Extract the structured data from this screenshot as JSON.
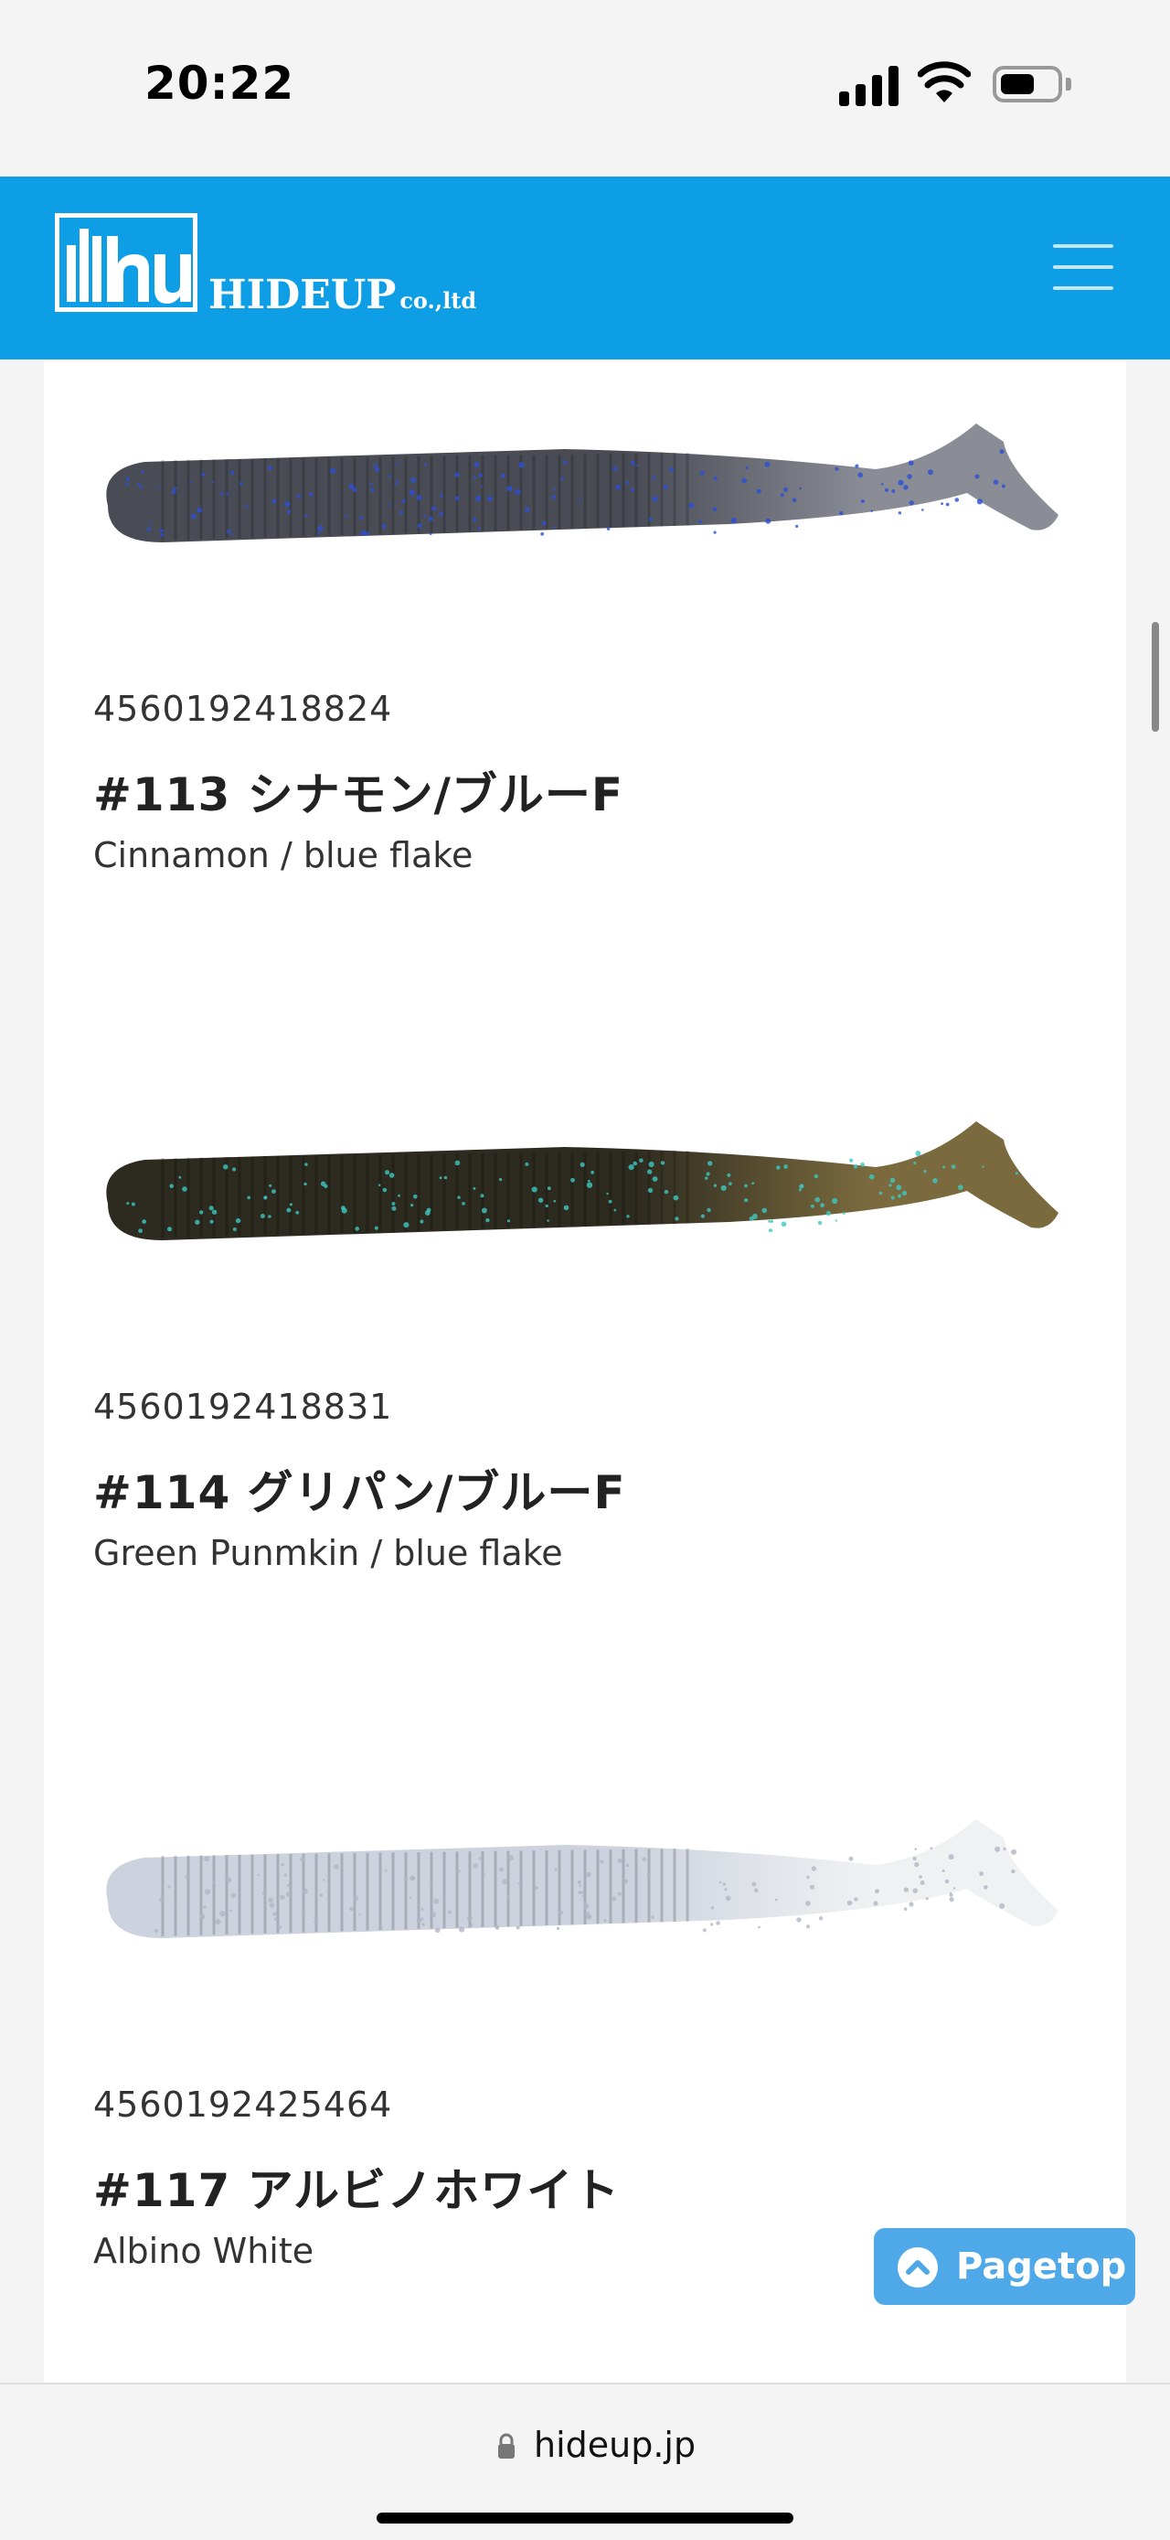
{
  "status_bar": {
    "time": "20:22",
    "icons": [
      "signal-icon",
      "wifi-icon",
      "battery-icon"
    ]
  },
  "header": {
    "logo_mark": "hu",
    "logo_name": "HIDEUP",
    "logo_suffix": "co.,ltd",
    "menu_icon": "hamburger-menu-icon",
    "bg_color": "#0e9ee6"
  },
  "products": [
    {
      "code": "4560192418824",
      "name_ja": "#113 シナモン/ブルーF",
      "name_en": "Cinnamon / blue flake",
      "body_color": "#4a4c55",
      "tail_color": "#8b8d96",
      "flake_color": "#2a4fd6"
    },
    {
      "code": "4560192418831",
      "name_ja": "#114 グリパン/ブルーF",
      "name_en": "Green Punmkin / blue flake",
      "body_color": "#2d2a1f",
      "tail_color": "#7a6a3e",
      "flake_color": "#3cc8c0"
    },
    {
      "code": "4560192425464",
      "name_ja": "#117 アルビノホワイト",
      "name_en": "Albino White",
      "body_color": "#cdd3de",
      "tail_color": "#f0f1f3",
      "flake_color": "#b0b6c4"
    }
  ],
  "pagetop": {
    "label": "Pagetop",
    "icon": "chevron-up-icon"
  },
  "browser": {
    "url": "hideup.jp",
    "lock_icon": "lock-icon"
  }
}
